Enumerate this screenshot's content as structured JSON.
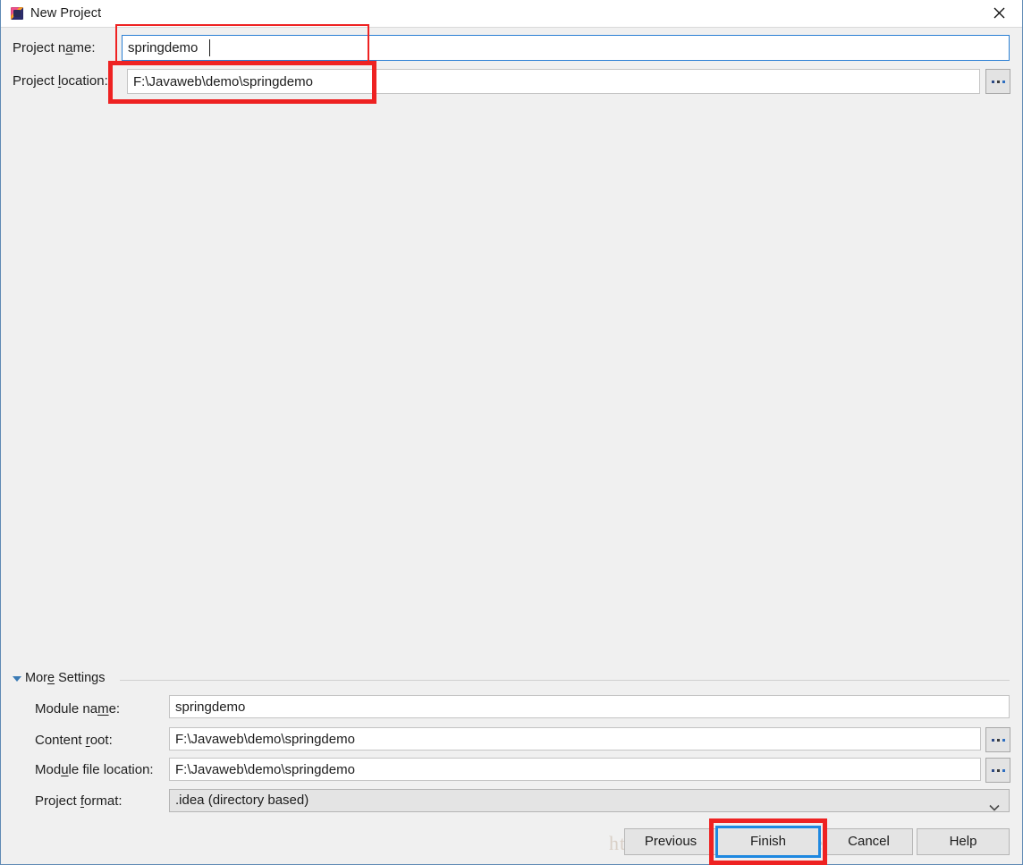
{
  "window": {
    "title": "New Project",
    "icon": "intellij-idea-icon",
    "close_label": "×"
  },
  "top_form": {
    "rows": [
      {
        "label_pre": "Project n",
        "label_mn": "a",
        "label_post": "me:",
        "value": "springdemo",
        "focused": true,
        "has_browse": false
      },
      {
        "label_pre": "Project ",
        "label_mn": "l",
        "label_post": "ocation:",
        "value": "F:\\Javaweb\\demo\\springdemo",
        "focused": false,
        "has_browse": true
      }
    ],
    "browse_label": "..."
  },
  "more_settings": {
    "label_pre": "Mor",
    "label_mn": "e",
    "label_post": " Settings",
    "expanded": true,
    "rows": [
      {
        "label_pre": "Module na",
        "label_mn": "m",
        "label_post": "e:",
        "value": "springdemo",
        "has_browse": false
      },
      {
        "label_pre": "Content ",
        "label_mn": "r",
        "label_post": "oot:",
        "value": "F:\\Javaweb\\demo\\springdemo",
        "has_browse": true
      },
      {
        "label_pre": "Mod",
        "label_mn": "u",
        "label_post": "le file location:",
        "value": "F:\\Javaweb\\demo\\springdemo",
        "has_browse": true
      }
    ],
    "project_format": {
      "label_pre": "Project ",
      "label_mn": "f",
      "label_post": "ormat:",
      "value": ".idea (directory based)",
      "options": [
        ".idea (directory based)"
      ]
    }
  },
  "footer": {
    "previous_label": "Previous",
    "finish_label": "Finish",
    "cancel_label": "Cancel",
    "help_label": "Help"
  },
  "watermark": {
    "text": "https://blog.csdn.net/chenxianwa"
  },
  "colors": {
    "accent_blue": "#1e88e0",
    "annotation_red": "#ee2222",
    "dialog_border": "#5f8ab5",
    "panel_bg": "#f0f0f0",
    "field_border_focus": "#2a7fd4"
  }
}
